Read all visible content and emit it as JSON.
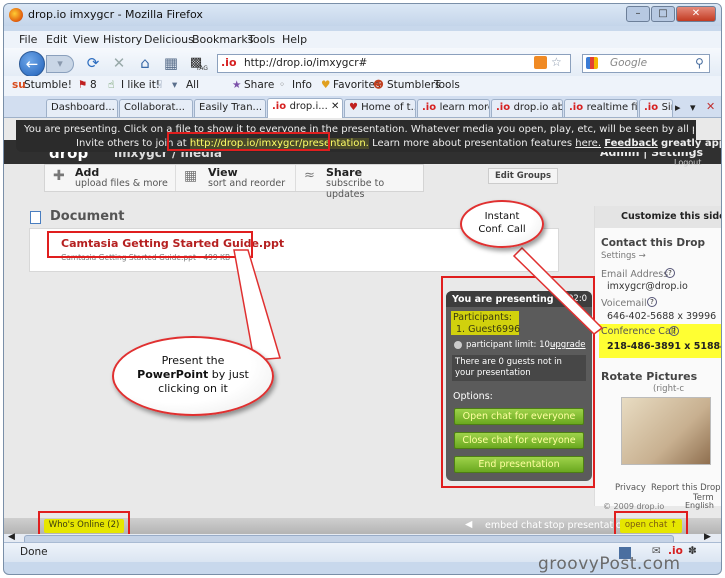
{
  "window": {
    "title": "drop.io imxygcr - Mozilla Firefox"
  },
  "menu": [
    "File",
    "Edit",
    "View",
    "History",
    "Delicious",
    "Bookmarks",
    "Tools",
    "Help"
  ],
  "nav": {
    "url": "http://drop.io/imxygcr#",
    "search_placeholder": "Google",
    "site_badge": ".io",
    "tag_label": "TAG"
  },
  "toolbar": {
    "stumble": "Stumble!",
    "count": "8",
    "like": "I like it!",
    "all": "All",
    "share": "Share",
    "info": "Info",
    "favorites": "Favorites",
    "stumblers": "Stumblers",
    "tools": "Tools"
  },
  "tabs": [
    "Dashboard...",
    "Collaborat...",
    "Easily Tran...",
    "drop.i...",
    "Home of t...",
    "learn more...",
    "drop.io ab...",
    "realtime fil...",
    "Sim"
  ],
  "banner": {
    "line1": "You are presenting. Click on a file to show it to everyone in the presentation. Whatever media you open, play, etc, will be seen by all participants.",
    "line2_prefix": "Invite others to join at",
    "invite_url": "http://drop.io/imxygcr/presentation.",
    "line2_suffix": "Learn more about presentation features",
    "here": "here.",
    "feedback": "Feedback",
    "appreciated": "greatly appreciated"
  },
  "header": {
    "logo": "drop",
    "drop_name": "imxygcr / media",
    "admin": "Admin | Settings",
    "logout": "Logout"
  },
  "actions": {
    "add_title": "Add",
    "add_sub": "upload files & more",
    "view_title": "View",
    "view_sub": "sort and reorder",
    "share_title": "Share",
    "share_sub": "subscribe to updates",
    "edit_groups": "Edit Groups"
  },
  "document": {
    "heading": "Document",
    "file_title": "Camtasia Getting Started Guide.ppt",
    "file_meta": "Camtasia Getting Started Guide.ppt - 499 KB"
  },
  "sidebar": {
    "customize": "Customize this sidebar",
    "contact_title": "Contact this Drop",
    "settings": "Settings →",
    "email_label": "Email Address",
    "email": "imxygcr@drop.io",
    "voicemail_label": "Voicemail",
    "voicemail": "646-402-5688 x 39996",
    "conf_label": "Conference Call",
    "conf": "218-486-3891 x 5188454",
    "rotate": "Rotate Pictures",
    "rotate_sub": "(right-c",
    "privacy": "Privacy",
    "report": "Report this Drop",
    "terms": "Term",
    "copyright": "© 2009 drop.io",
    "english": "English"
  },
  "presenting": {
    "title": "You are presenting",
    "time": "02:0",
    "participants_label": "Participants:",
    "guest": "1.  Guest6996",
    "limit": "participant limit: 10 -",
    "upgrade": "upgrade",
    "not_in": "There are 0 guests not in your presentation",
    "options": "Options:",
    "btn_open": "Open chat for everyone",
    "btn_close": "Close chat for everyone",
    "btn_end": "End presentation"
  },
  "callouts": {
    "conf_call": "Instant\nConf. Call",
    "present_pre": "Present the",
    "present_bold": "PowerPoint",
    "present_post": "by just clicking on it"
  },
  "bottom": {
    "whos_online": "Who's Online (2)",
    "embed_chat": "embed chat",
    "stop_presentation": "stop presentation",
    "open_chat": "open chat"
  },
  "status": {
    "text": "Done"
  },
  "watermark": "groovyPost.com",
  "colors": {
    "accent_red": "#e01e1e",
    "presenting_green": "#7cbc2c",
    "highlight_yellow": "#ffff33",
    "doc_title_red": "#b52020"
  }
}
